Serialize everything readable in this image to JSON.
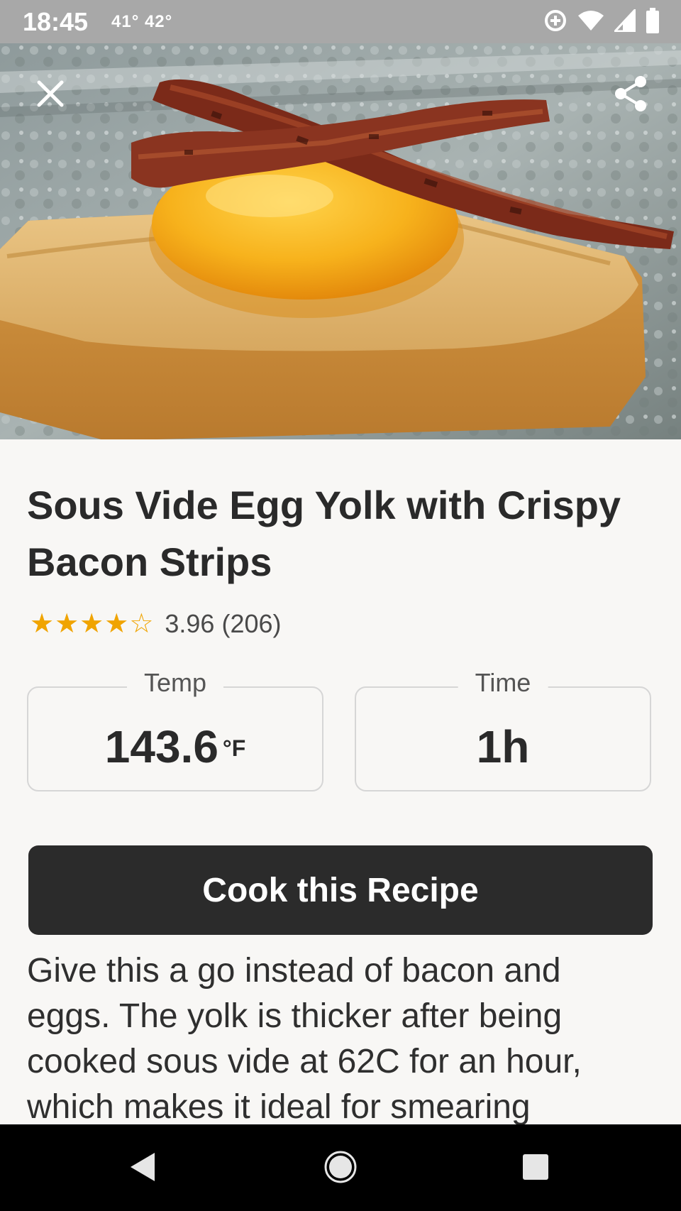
{
  "status_bar": {
    "time": "18:45",
    "temps": "41° 42°",
    "icons": [
      "data-saver-icon",
      "wifi-icon",
      "signal-icon",
      "battery-icon"
    ]
  },
  "hero": {
    "close_icon": "close-icon",
    "share_icon": "share-icon",
    "image_subject": "egg yolk on toast with bacon"
  },
  "recipe": {
    "title": "Sous Vide Egg Yolk with Crispy Bacon Strips",
    "rating": {
      "stars_filled": 4,
      "stars_total": 5,
      "text": "3.96 (206)"
    },
    "temp": {
      "label": "Temp",
      "value": "143.6",
      "unit": "°F"
    },
    "time": {
      "label": "Time",
      "value": "1h"
    },
    "cook_button": "Cook this Recipe",
    "description": "Give this a go instead of bacon and eggs. The yolk is thicker after being cooked sous vide at 62C for an hour, which makes it ideal for smearing"
  },
  "nav_bar": {
    "icons": [
      "back-icon",
      "home-icon",
      "recents-icon"
    ]
  },
  "colors": {
    "star": "#f0a400",
    "button_bg": "#2b2b2b",
    "page_bg": "#f8f7f5",
    "status_bar": "#a8a8a8"
  }
}
